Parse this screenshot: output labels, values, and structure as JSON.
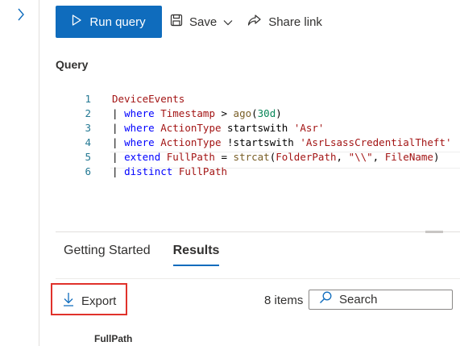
{
  "toolbar": {
    "run_label": "Run query",
    "save_label": "Save",
    "share_label": "Share link"
  },
  "editor": {
    "section_label": "Query",
    "lines": [
      {
        "num": "1",
        "parts": [
          {
            "t": "DeviceEvents",
            "c": "tbl"
          }
        ]
      },
      {
        "num": "2",
        "parts": [
          {
            "t": "| ",
            "c": "op"
          },
          {
            "t": "where",
            "c": "kw"
          },
          {
            "t": " ",
            "c": "op"
          },
          {
            "t": "Timestamp",
            "c": "fld"
          },
          {
            "t": " > ",
            "c": "op"
          },
          {
            "t": "ago",
            "c": "fn"
          },
          {
            "t": "(",
            "c": "op"
          },
          {
            "t": "30d",
            "c": "num"
          },
          {
            "t": ")",
            "c": "op"
          }
        ]
      },
      {
        "num": "3",
        "parts": [
          {
            "t": "| ",
            "c": "op"
          },
          {
            "t": "where",
            "c": "kw"
          },
          {
            "t": " ",
            "c": "op"
          },
          {
            "t": "ActionType",
            "c": "fld"
          },
          {
            "t": " startswith ",
            "c": "op"
          },
          {
            "t": "'Asr'",
            "c": "str"
          }
        ]
      },
      {
        "num": "4",
        "parts": [
          {
            "t": "| ",
            "c": "op"
          },
          {
            "t": "where",
            "c": "kw"
          },
          {
            "t": " ",
            "c": "op"
          },
          {
            "t": "ActionType",
            "c": "fld"
          },
          {
            "t": " !startswith ",
            "c": "op"
          },
          {
            "t": "'AsrLsassCredentialTheft'",
            "c": "str"
          }
        ]
      },
      {
        "num": "5",
        "parts": [
          {
            "t": "| ",
            "c": "op"
          },
          {
            "t": "extend",
            "c": "kw"
          },
          {
            "t": " ",
            "c": "op"
          },
          {
            "t": "FullPath",
            "c": "fld"
          },
          {
            "t": " = ",
            "c": "op"
          },
          {
            "t": "strcat",
            "c": "fn"
          },
          {
            "t": "(",
            "c": "op"
          },
          {
            "t": "FolderPath",
            "c": "fld"
          },
          {
            "t": ", ",
            "c": "op"
          },
          {
            "t": "\"\\\\\"",
            "c": "str"
          },
          {
            "t": ", ",
            "c": "op"
          },
          {
            "t": "FileName",
            "c": "fld"
          },
          {
            "t": ")",
            "c": "op"
          }
        ]
      },
      {
        "num": "6",
        "parts": [
          {
            "t": "| ",
            "c": "op"
          },
          {
            "t": "distinct",
            "c": "kw"
          },
          {
            "t": " ",
            "c": "op"
          },
          {
            "t": "FullPath",
            "c": "fld"
          }
        ]
      }
    ]
  },
  "tabs": [
    {
      "label": "Getting Started",
      "active": false
    },
    {
      "label": "Results",
      "active": true
    }
  ],
  "results": {
    "export_label": "Export",
    "count_text": "8 items",
    "search_placeholder": "Search",
    "column_header": "FullPath"
  },
  "colors": {
    "accent": "#0f6cbd",
    "highlight_border": "#e0322b"
  }
}
